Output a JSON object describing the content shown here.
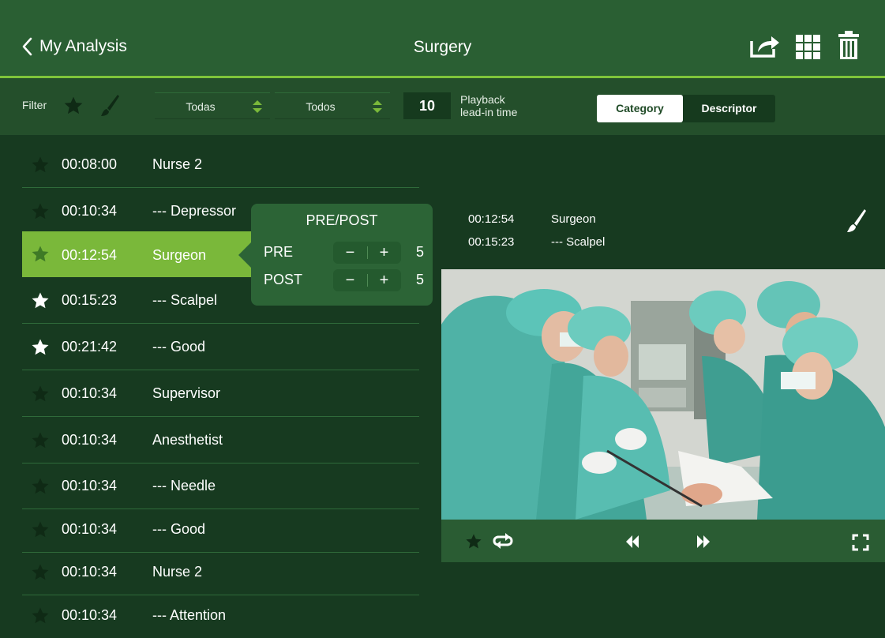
{
  "header": {
    "back_label": "My Analysis",
    "title": "Surgery",
    "icons": [
      "share-icon",
      "grid-icon",
      "trash-icon"
    ]
  },
  "toolbar": {
    "filter_label": "Filter",
    "select_1_value": "Todas",
    "select_2_value": "Todos",
    "leadin_value": "10",
    "leadin_label_line1": "Playback",
    "leadin_label_line2": "lead-in time",
    "segment_category": "Category",
    "segment_descriptor": "Descriptor",
    "segment_selected": "Category"
  },
  "list": {
    "rows": [
      {
        "time": "00:08:00",
        "label": "Nurse 2",
        "starred": false
      },
      {
        "time": "00:10:34",
        "label": "--- Depressor",
        "starred": false
      },
      {
        "time": "00:12:54",
        "label": "Surgeon",
        "starred": false,
        "selected": true
      },
      {
        "time": "00:15:23",
        "label": "--- Scalpel",
        "starred": true
      },
      {
        "time": "00:21:42",
        "label": "--- Good",
        "starred": true
      },
      {
        "time": "00:10:34",
        "label": "Supervisor",
        "starred": false
      },
      {
        "time": "00:10:34",
        "label": "Anesthetist",
        "starred": false
      },
      {
        "time": "00:10:34",
        "label": "--- Needle",
        "starred": false
      },
      {
        "time": "00:10:34",
        "label": "--- Good",
        "starred": false
      },
      {
        "time": "00:10:34",
        "label": "Nurse 2",
        "starred": false
      },
      {
        "time": "00:10:34",
        "label": "--- Attention",
        "starred": false
      }
    ]
  },
  "popup": {
    "title": "PRE/POST",
    "pre_label": "PRE",
    "pre_value": "5",
    "post_label": "POST",
    "post_value": "5",
    "minus": "−",
    "plus": "+"
  },
  "detail": {
    "entries": [
      {
        "time": "00:12:54",
        "label": "Surgeon"
      },
      {
        "time": "00:15:23",
        "label": "--- Scalpel"
      }
    ]
  },
  "colors": {
    "background": "#173a20",
    "header": "#2a5f33",
    "accent": "#7ab83a",
    "star_dark": "#0f2a15"
  }
}
